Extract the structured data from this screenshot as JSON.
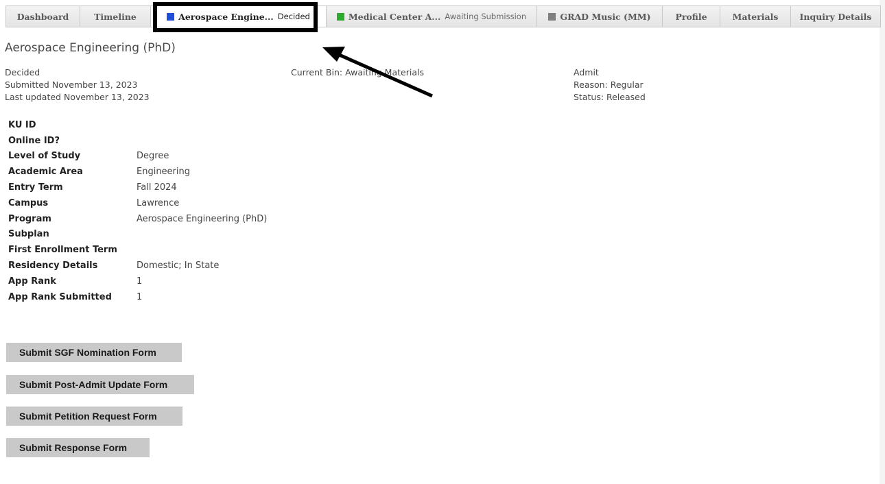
{
  "tabs": [
    {
      "label": "Dashboard"
    },
    {
      "label": "Timeline"
    },
    {
      "label": "Aerospace Engine...",
      "status": "Decided",
      "color": "#1f4fd8"
    },
    {
      "label": "Medical Center A...",
      "status": "Awaiting Submission",
      "color": "#2eaa2e"
    },
    {
      "label": "GRAD Music (MM)",
      "color": "#808080"
    },
    {
      "label": "Profile"
    },
    {
      "label": "Materials"
    },
    {
      "label": "Inquiry Details"
    }
  ],
  "application": {
    "title": "Aerospace Engineering (PhD)",
    "status": "Decided",
    "submitted": "Submitted November 13, 2023",
    "updated": "Last updated November 13, 2023",
    "bin": "Current Bin: Awaiting Materials",
    "decision": "Admit",
    "reason": "Reason: Regular",
    "release_status": "Status: Released"
  },
  "details": [
    {
      "label": "KU ID",
      "value": ""
    },
    {
      "label": "Online ID?",
      "value": ""
    },
    {
      "label": "Level of Study",
      "value": "Degree"
    },
    {
      "label": "Academic Area",
      "value": "Engineering"
    },
    {
      "label": "Entry Term",
      "value": "Fall 2024"
    },
    {
      "label": "Campus",
      "value": "Lawrence"
    },
    {
      "label": "Program",
      "value": "Aerospace Engineering (PhD)"
    },
    {
      "label": "Subplan",
      "value": ""
    },
    {
      "label": "First Enrollment Term",
      "value": ""
    },
    {
      "label": "Residency Details",
      "value": "Domestic; In State"
    },
    {
      "label": "App Rank",
      "value": "1"
    },
    {
      "label": "App Rank Submitted",
      "value": "1"
    }
  ],
  "buttons": {
    "sgf": "Submit SGF Nomination Form",
    "post_admit": "Submit Post-Admit Update Form",
    "petition": "Submit Petition Request Form",
    "response": "Submit Response Form"
  }
}
